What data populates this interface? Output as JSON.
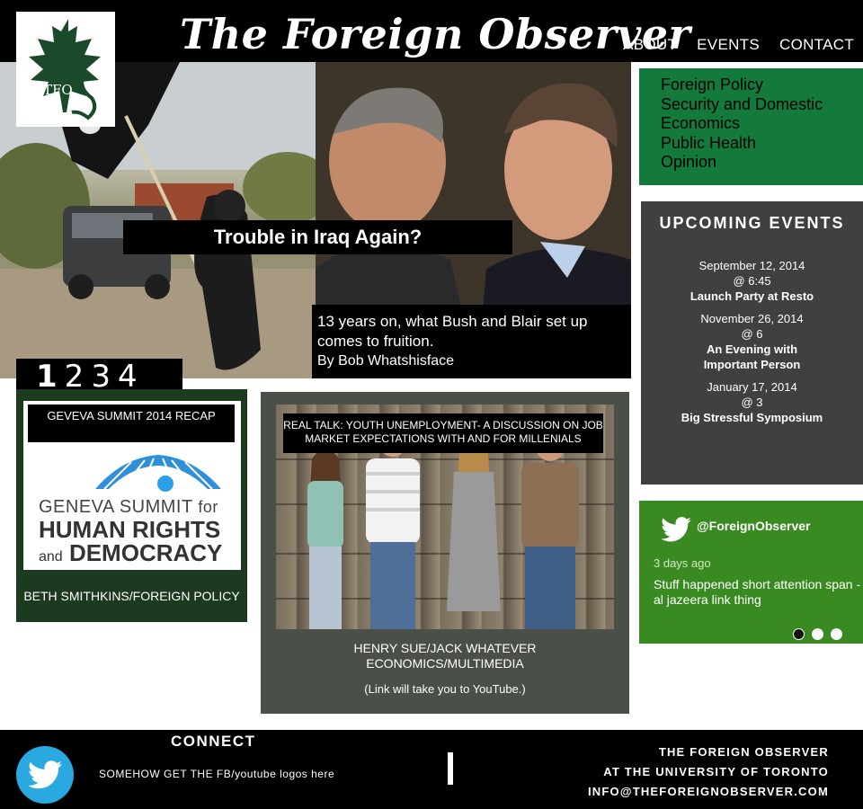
{
  "header": {
    "logo_text": "TFO",
    "site_title": "The Foreign Observer",
    "nav": [
      "ABOUT",
      "EVENTS",
      "CONTACT"
    ]
  },
  "hero": {
    "title": "Trouble in Iraq Again?",
    "caption": "13 years on, what Bush and Blair set up comes to fruition.",
    "byline": "By Bob Whatshisface"
  },
  "pager": {
    "pages": [
      "1",
      "2",
      "3",
      "4"
    ],
    "active_page": "1"
  },
  "categories": [
    "Foreign Policy",
    "Security and Domestic",
    "Economics",
    "Public Health",
    "Opinion"
  ],
  "events": {
    "heading": "UPCOMING EVENTS",
    "items": [
      {
        "date": "September 12, 2014",
        "time": "@ 6:45",
        "title": "Launch Party at Resto"
      },
      {
        "date": "November 26, 2014",
        "time": "@ 6",
        "title": "An Evening with Important Person"
      },
      {
        "date": "January 17, 2014",
        "time": "@ 3",
        "title": "Big Stressful Symposium"
      }
    ]
  },
  "twitter": {
    "handle": "@ForeignObserver",
    "time": "3 days ago",
    "text": "Stuff happened short attention span - al jazeera link thing",
    "dots": 3,
    "active_dot": 0
  },
  "card1": {
    "label": "GEVEVA SUMMIT 2014 RECAP",
    "image_line1": "GENEVA SUMMIT",
    "image_line1_suffix": "for",
    "image_line2": "HUMAN RIGHTS",
    "image_line3_prefix": "and",
    "image_line3": "DEMOCRACY",
    "credit": "BETH SMITHKINS/FOREIGN POLICY"
  },
  "card2": {
    "label": "REAL TALK: YOUTH UNEMPLOYMENT- A DISCUSSION ON JOB MARKET EXPECTATIONS WITH AND FOR MILLENIALS",
    "credit_line1": "HENRY SUE/JACK WHATEVER",
    "credit_line2": "ECONOMICS/MULTIMEDIA",
    "note": "(Link will take you to YouTube.)"
  },
  "footer": {
    "connect": "CONNECT",
    "note": "SOMEHOW GET THE FB/youtube logos here",
    "info": [
      "THE FOREIGN OBSERVER",
      "AT THE UNIVERSITY OF TORONTO",
      "INFO@THEFOREIGNOBSERVER.COM"
    ]
  },
  "colors": {
    "header": "#000000",
    "category_green": "#147a3c",
    "events_gray": "#404040",
    "twitter_green": "#3a8a22",
    "card1_green": "#1c3a1f",
    "card2_gray": "#4a4f48",
    "twitter_blue": "#29a9e0"
  }
}
